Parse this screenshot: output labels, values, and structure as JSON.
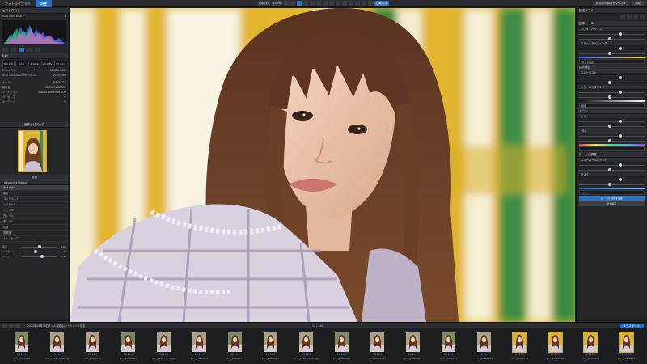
{
  "topbar": {
    "tabs": [
      {
        "label": "フォトライブラリ",
        "active": false
      },
      {
        "label": "調整",
        "active": true
      }
    ],
    "center_tools": [
      "比較(3)",
      "100%",
      "",
      "",
      "",
      "",
      "",
      "",
      "",
      "",
      "",
      "",
      "",
      "",
      "",
      "",
      "比較表示"
    ],
    "right_buttons": [
      "最適化の調整をリセット",
      "比較"
    ]
  },
  "left_panel": {
    "histogram_header": "ヒストグラム",
    "histogram_caption": "RGB RGB RGB",
    "exif_header": "Exif",
    "exif_values": [
      "ISO 100",
      "f/2.8",
      "1/1250 s",
      "+0.0 EV",
      "85 mm"
    ],
    "info_rows": [
      {
        "label": "Nikon Z 6",
        "value": "6000 x 4000"
      },
      {
        "label": "AF-S NIKKOR 85mm f/1.4G",
        "value": "2022/1/00"
      }
    ],
    "meta_rows": [
      {
        "label": "カメラ",
        "value": "NIKON Z 6"
      },
      {
        "label": "撮影者",
        "value": "SUZUKI WATARU"
      },
      {
        "label": "ソフトウェア",
        "value": "NIKON CORPORATION"
      },
      {
        "label": "ライセンス",
        "value": "一"
      },
      {
        "label": "キーワード",
        "value": "一"
      }
    ],
    "navigator_header": "画像ナビゲータ",
    "history_header": "履歴",
    "history_title": "Advanced History",
    "history_items": [
      "オリジナル",
      "露出",
      "コントラスト",
      "ハイライト",
      "シャドウ",
      "白レベル",
      "黒レベル",
      "彩度",
      "明瞭度",
      "トーンカーブ"
    ],
    "sliders": [
      {
        "label": "露出",
        "value": "0.00",
        "pos": 0.5
      },
      {
        "label": "ハイライト",
        "value": "-20",
        "pos": 0.4
      },
      {
        "label": "シャドウ",
        "value": "+15",
        "pos": 0.58
      }
    ]
  },
  "right_panel": {
    "top_header": "設定パネル",
    "sections": [
      {
        "title": "基本ツール",
        "sub": [
          "ホワイトバランス",
          "スマートライティング"
        ],
        "field": "カメラ設定"
      },
      {
        "title": "露光補正",
        "sub": [
          "コントラスト",
          "カラーレンダリング"
        ],
        "field": "標準"
      },
      {
        "title": "トーン",
        "sub": [
          "カラー",
          "HSL"
        ],
        "field": "—"
      },
      {
        "title": "ローカル調整",
        "sub": [
          "コントロールポイント",
          "マスク"
        ],
        "field": "ブラシ"
      }
    ],
    "buttons": [
      "ローカル調整を追加",
      "自動補正"
    ]
  },
  "filmstrip": {
    "path": "2022年05月28日ミツル撮影会/ポートレート撮影",
    "count": "12 / 180",
    "export_label": "エクスポート",
    "items": [
      {
        "name": "DSF_22060400",
        "selected": false
      },
      {
        "name": "DSF_2118…S_98.jpg",
        "selected": false
      },
      {
        "name": "DSF_22060401",
        "selected": false
      },
      {
        "name": "DSF_22060402",
        "selected": false
      },
      {
        "name": "DSF_2118…S_36.jpg",
        "selected": false
      },
      {
        "name": "DSF_22060403",
        "selected": false
      },
      {
        "name": "DSF_22060404",
        "selected": false
      },
      {
        "name": "DSF_22060405",
        "selected": false
      },
      {
        "name": "DSF_2118…S_98.jpg",
        "selected": false
      },
      {
        "name": "DSF_22060406",
        "selected": false
      },
      {
        "name": "DSF_22060407",
        "selected": false
      },
      {
        "name": "DSF_22060408",
        "selected": false
      },
      {
        "name": "DSF_22060409",
        "selected": false
      },
      {
        "name": "DSF_22060410",
        "selected": false
      },
      {
        "name": "DSF_22060411",
        "selected": true
      },
      {
        "name": "DSF_22060412",
        "selected": true
      },
      {
        "name": "DSF_22060413",
        "selected": true
      },
      {
        "name": "DSF_22060414",
        "selected": true
      }
    ]
  },
  "colors": {
    "accent": "#2e6fbf",
    "select": "#d8a12a",
    "panel": "#24262a"
  }
}
